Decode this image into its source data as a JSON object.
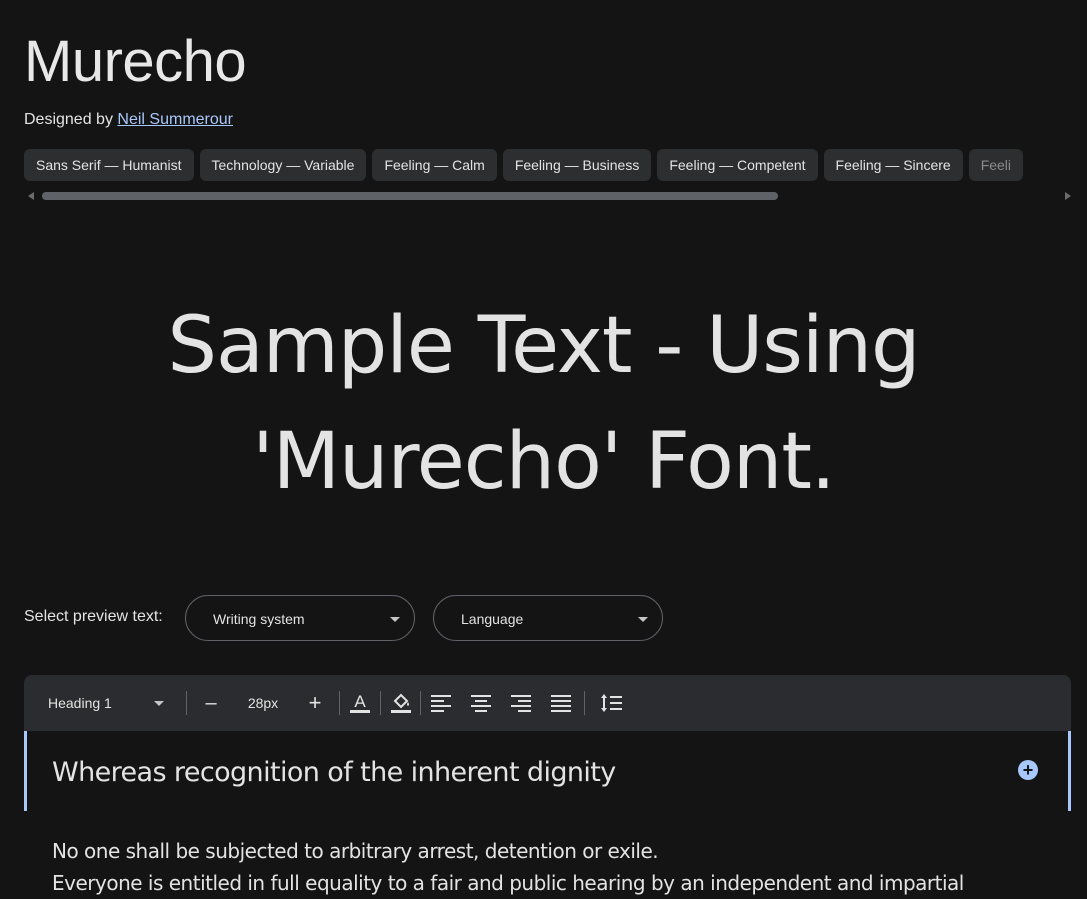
{
  "font": {
    "name": "Murecho"
  },
  "designer": {
    "prefix": "Designed by",
    "name": "Neil Summerour"
  },
  "tags": [
    "Sans Serif — Humanist",
    "Technology — Variable",
    "Feeling — Calm",
    "Feeling — Business",
    "Feeling — Competent",
    "Feeling — Sincere",
    "Feeli"
  ],
  "sample": {
    "line1": "Sample Text - Using",
    "line2": "'Murecho' Font."
  },
  "preview": {
    "label": "Select preview text:",
    "writing_system": "Writing system",
    "language": "Language"
  },
  "toolbar": {
    "style": "Heading 1",
    "minus": "–",
    "size": "28px",
    "plus": "+"
  },
  "editor": {
    "heading": "Whereas recognition of the inherent dignity",
    "add": "+",
    "paragraph": [
      "No one shall be subjected to arbitrary arrest, detention or exile.",
      "Everyone is entitled in full equality to a fair and public hearing by an independent and impartial"
    ]
  },
  "colors": {
    "background": "#141414",
    "chip": "#2d2e30",
    "accent": "#a8c7fa",
    "toolbar": "#2b2c2f"
  }
}
